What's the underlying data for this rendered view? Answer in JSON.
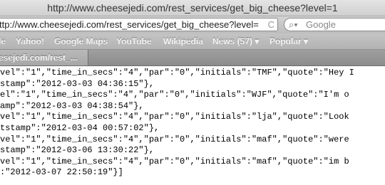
{
  "window": {
    "title": "http://www.cheesejedi.com/rest_services/get_big_cheese?level=1"
  },
  "toolbar": {
    "url": "ttp://www.cheesejedi.com/rest_services/get_big_cheese?level=",
    "reload_glyph": "C",
    "search_placeholder": "Google"
  },
  "bookmarks": [
    {
      "label": "le"
    },
    {
      "label": "Yahoo!"
    },
    {
      "label": "Google Maps"
    },
    {
      "label": "YouTube"
    },
    {
      "label": "Wikipedia"
    },
    {
      "label": "News (57) ▾"
    },
    {
      "label": "Popular ▾"
    }
  ],
  "tab": {
    "label": "esejedi.com/rest_..."
  },
  "content": {
    "lines": [
      "vel\":\"1\",\"time_in_secs\":\"4\",\"par\":\"0\",\"initials\":\"TMF\",\"quote\":\"Hey I",
      "stamp\":\"2012-03-03 04:36:15\"},",
      "el\":\"1\",\"time_in_secs\":\"4\",\"par\":\"0\",\"initials\":\"WJF\",\"quote\":\"I'm o",
      "amp\":\"2012-03-03 04:38:54\"},",
      "vel\":\"1\",\"time_in_secs\":\"4\",\"par\":\"0\",\"initials\":\"lja\",\"quote\":\"Look",
      "tstamp\":\"2012-03-04 00:57:02\"},",
      "vel\":\"1\",\"time_in_secs\":\"4\",\"par\":\"0\",\"initials\":\"maf\",\"quote\":\"were",
      "stamp\":\"2012-03-06 13:30:22\"},",
      "vel\":\"1\",\"time_in_secs\":\"4\",\"par\":\"0\",\"initials\":\"maf\",\"quote\":\"im b",
      ":\"2012-03-07 22:50:19\"}]"
    ]
  }
}
